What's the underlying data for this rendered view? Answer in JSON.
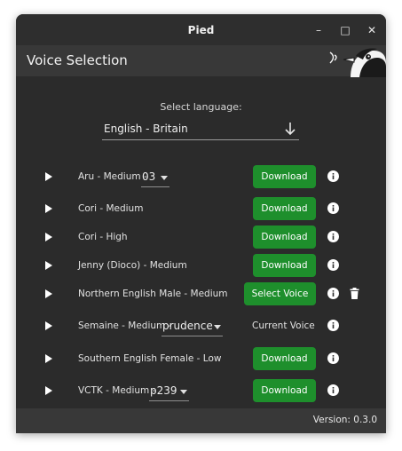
{
  "window": {
    "title": "Pied",
    "minimize_glyph": "–",
    "maximize_glyph": "□",
    "close_glyph": "✕"
  },
  "appbar": {
    "title": "Voice Selection",
    "logo_icon": "penguin-logo"
  },
  "language": {
    "label": "Select language:",
    "value": "English - Britain"
  },
  "voices": [
    {
      "name": "Aru - Medium -",
      "speaker": "03",
      "action": "Download"
    },
    {
      "name": "Cori - Medium",
      "action": "Download"
    },
    {
      "name": "Cori - High",
      "action": "Download"
    },
    {
      "name": "Jenny (Dioco) - Medium",
      "action": "Download"
    },
    {
      "name": "Northern English Male - Medium",
      "action": "Select Voice"
    },
    {
      "name": "Semaine - Medium -",
      "speaker": "prudence",
      "status": "Current Voice"
    },
    {
      "name": "Southern English Female - Low",
      "action": "Download"
    },
    {
      "name": "VCTK - Medium -",
      "speaker": "p239",
      "action": "Download"
    }
  ],
  "footer": {
    "version": "Version: 0.3.0"
  },
  "colors": {
    "accent_green": "#1e8f2c",
    "background": "#2b2b2b",
    "bar": "#383838"
  }
}
